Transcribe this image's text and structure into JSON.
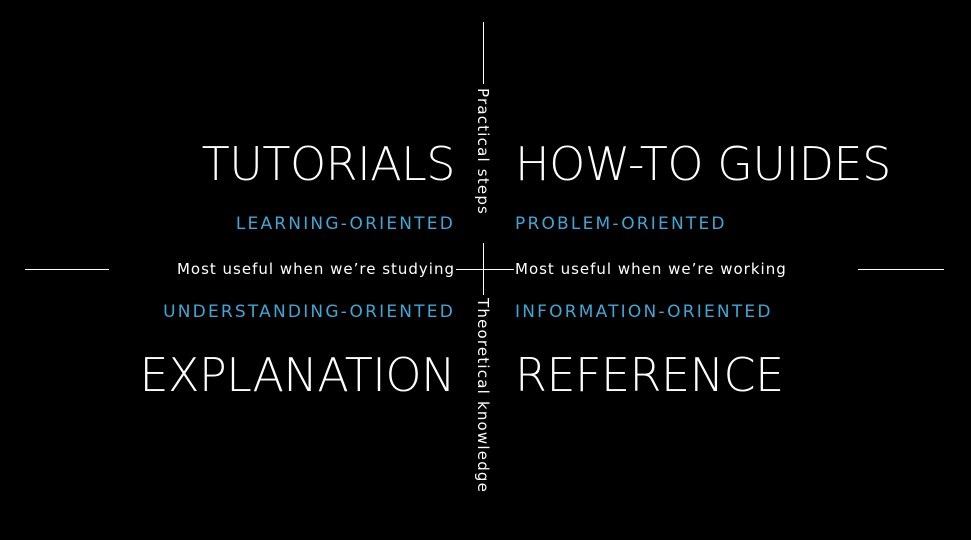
{
  "colors": {
    "background": "#000000",
    "text": "#ffffff",
    "accent": "#3fa7d6"
  },
  "quadrants": {
    "top_left": {
      "title": "TUTORIALS",
      "orientation": "LEARNING-ORIENTED"
    },
    "top_right": {
      "title": "HOW-TO GUIDES",
      "orientation": "PROBLEM-ORIENTED"
    },
    "bottom_left": {
      "title": "EXPLANATION",
      "orientation": "UNDERSTANDING-ORIENTED"
    },
    "bottom_right": {
      "title": "REFERENCE",
      "orientation": "INFORMATION-ORIENTED"
    }
  },
  "axes": {
    "vertical_top": "Practical steps",
    "vertical_bottom": "Theoretical knowledge",
    "horizontal_left": "Most useful when we’re studying",
    "horizontal_right": "Most useful when we’re working"
  }
}
